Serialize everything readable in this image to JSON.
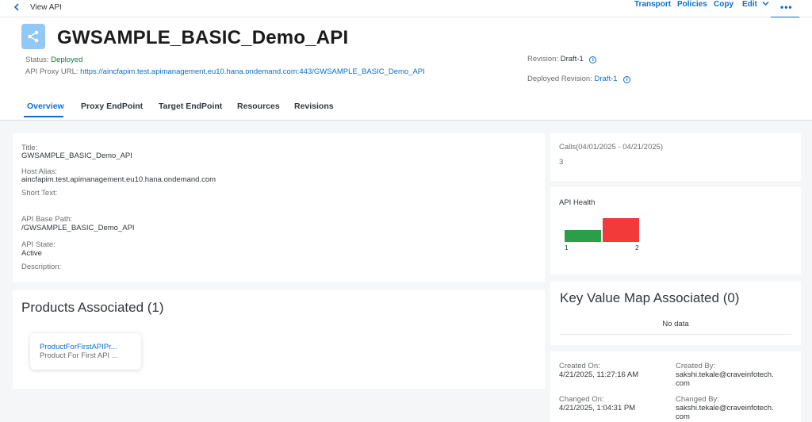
{
  "topbar": {
    "back_icon": "chevron-left-icon",
    "title": "View API",
    "transport": "Transport",
    "policies": "Policies",
    "copy": "Copy",
    "edit": "Edit",
    "more": "•••"
  },
  "header": {
    "api_icon": "share-icon",
    "api_name": "GWSAMPLE_BASIC_Demo_API",
    "status_label": "Status:",
    "status_value": "Deployed",
    "proxy_url_label": "API Proxy URL:",
    "proxy_url_value": "https://aincfapim.test.apimanagement.eu10.hana.ondemand.com:443/GWSAMPLE_BASIC_Demo_API",
    "revision_label": "Revision:",
    "revision_value": "Draft-1",
    "deployed_revision_label": "Deployed Revision:",
    "deployed_revision_value": "Draft-1"
  },
  "tabs": [
    "Overview",
    "Proxy EndPoint",
    "Target EndPoint",
    "Resources",
    "Revisions"
  ],
  "details": {
    "title_label": "Title:",
    "title_value": "GWSAMPLE_BASIC_Demo_API",
    "host_alias_label": "Host Alias:",
    "host_alias_value": "aincfapim.test.apimanagement.eu10.hana.ondemand.com",
    "short_text_label": "Short Text:",
    "base_path_label": "API Base Path:",
    "base_path_value": "/GWSAMPLE_BASIC_Demo_API",
    "state_label": "API State:",
    "state_value": "Active",
    "description_label": "Description:"
  },
  "products": {
    "title": "Products Associated (1)",
    "items": [
      {
        "name": "ProductForFirstAPIPr...",
        "description": "Product For First API ..."
      }
    ]
  },
  "calls": {
    "label": "Calls(04/01/2025 - 04/21/2025)",
    "value": "3"
  },
  "health": {
    "title": "API Health",
    "colors": {
      "healthy": "#2b9e4a",
      "critical": "#f23a3a"
    },
    "chart_data": {
      "type": "bar",
      "categories": [
        "1",
        "2"
      ],
      "values": [
        1,
        2
      ],
      "colors": [
        "#2b9e4a",
        "#f23a3a"
      ]
    }
  },
  "kvm": {
    "title": "Key Value Map Associated (0)",
    "no_data": "No data"
  },
  "audit": {
    "created_on_label": "Created On:",
    "created_on_value": "4/21/2025, 11:27:16 AM",
    "created_by_label": "Created By:",
    "created_by_value_1": "sakshi.tekale@craveinfotech.",
    "created_by_value_2": "com",
    "changed_on_label": "Changed On:",
    "changed_on_value": "4/21/2025, 1:04:31 PM",
    "changed_by_label": "Changed By:",
    "changed_by_value_1": "sakshi.tekale@craveinfotech.",
    "changed_by_value_2": "com"
  },
  "colors": {
    "accent": "#0a6ed1",
    "success": "#107e3e",
    "icon_bg": "#91c8f6"
  }
}
